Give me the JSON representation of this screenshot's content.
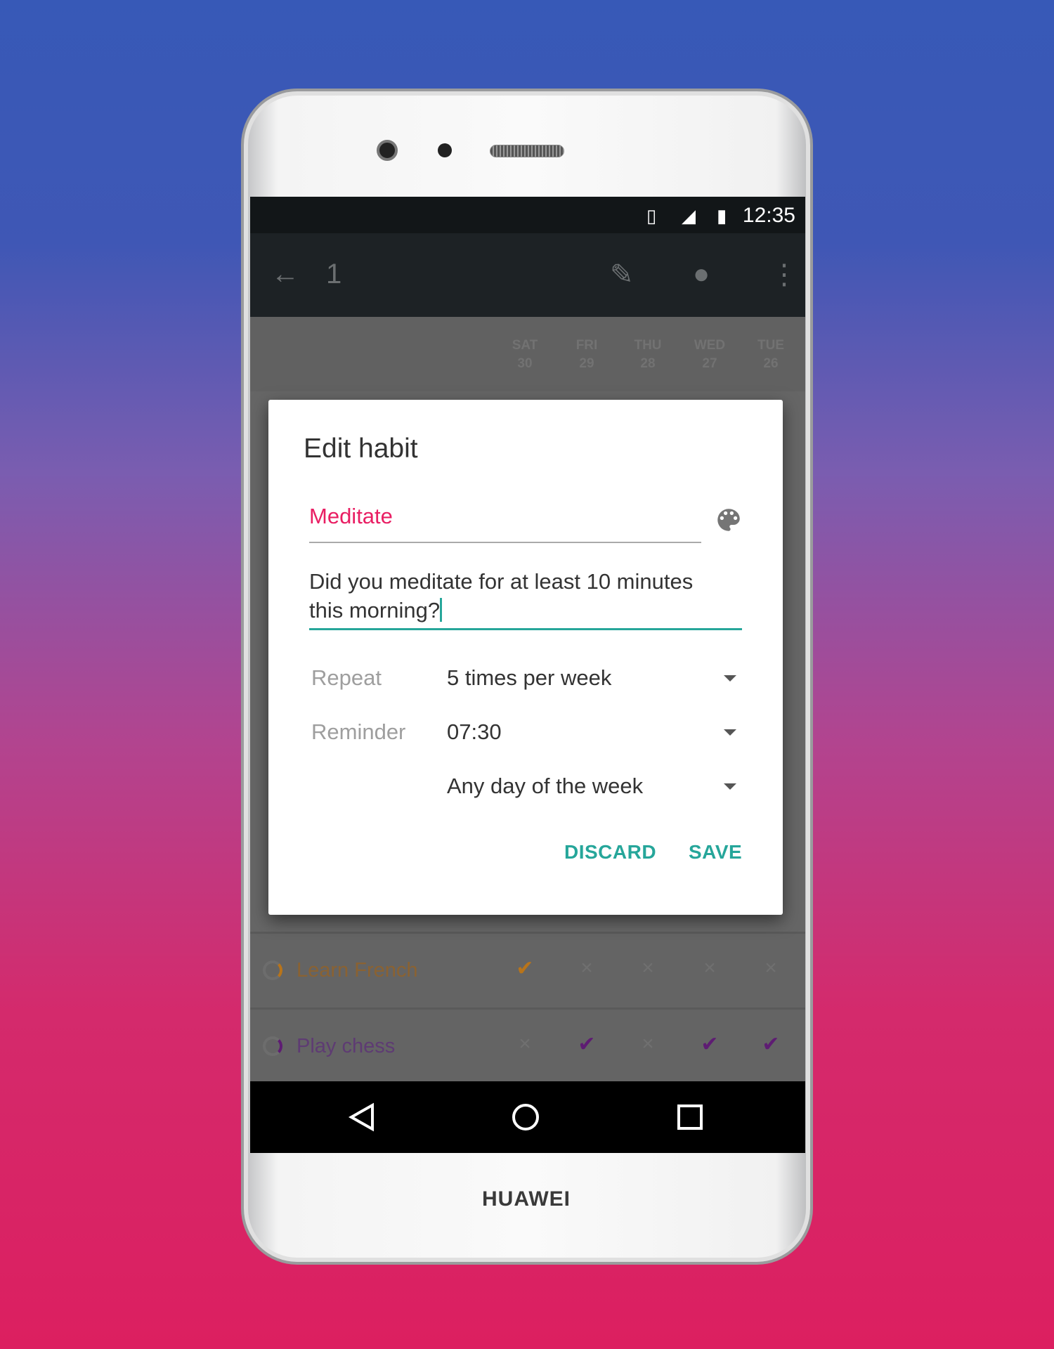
{
  "device": {
    "brand": "HUAWEI"
  },
  "status_bar": {
    "time": "12:35",
    "icons": [
      "vibrate-icon",
      "signal-3g-icon",
      "battery-icon"
    ]
  },
  "toolbar": {
    "title": "1",
    "icons": [
      "back-arrow-icon",
      "pencil-icon",
      "palette-icon",
      "more-vert-icon"
    ]
  },
  "days": [
    {
      "d": "SAT",
      "n": "30"
    },
    {
      "d": "FRI",
      "n": "29"
    },
    {
      "d": "THU",
      "n": "28"
    },
    {
      "d": "WED",
      "n": "27"
    },
    {
      "d": "TUE",
      "n": "26"
    }
  ],
  "habits": [
    {
      "name": "Learn French",
      "color": "#b8741a",
      "marks": [
        "check",
        "x",
        "x",
        "x",
        "x"
      ]
    },
    {
      "name": "Play chess",
      "color": "#5e1c73",
      "marks": [
        "x",
        "check",
        "x",
        "check",
        "check"
      ]
    }
  ],
  "dialog": {
    "title": "Edit habit",
    "name_value": "Meditate",
    "question_line1": "Did you meditate for at least 10 minutes",
    "question_line2": "this morning?",
    "repeat_label": "Repeat",
    "repeat_value": "5 times per week",
    "reminder_label": "Reminder",
    "reminder_value": "07:30",
    "reminder_days": "Any day of the week",
    "discard": "DISCARD",
    "save": "SAVE",
    "accent": "#26a69a",
    "name_color": "#e91e63"
  },
  "nav": {
    "icons": [
      "back-icon",
      "home-icon",
      "recents-icon"
    ]
  }
}
